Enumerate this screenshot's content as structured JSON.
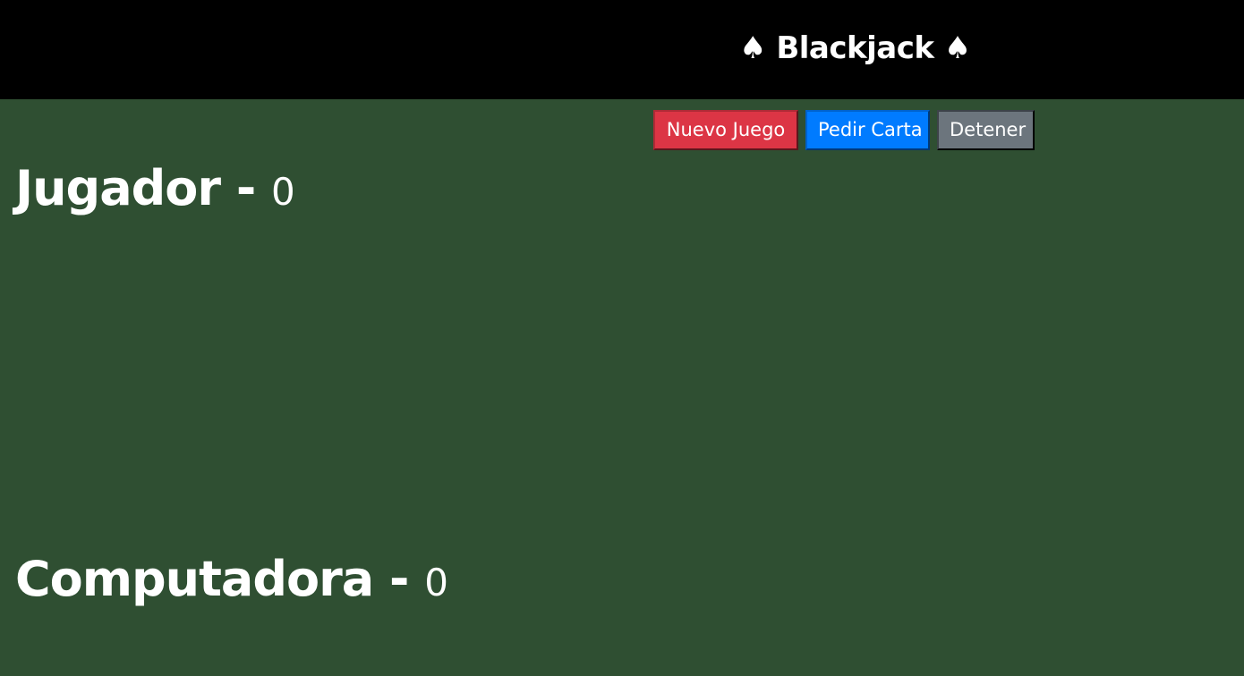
{
  "header": {
    "title": "♠ Blackjack ♠"
  },
  "controls": {
    "new_game_label": "Nuevo Juego",
    "hit_label": "Pedir Carta",
    "stand_label": "Detener"
  },
  "player": {
    "label": "Jugador",
    "separator": " - ",
    "score": "0"
  },
  "computer": {
    "label": "Computadora",
    "separator": " - ",
    "score": "0"
  },
  "colors": {
    "table": "#2f4f32",
    "header": "#000000",
    "danger": "#dc3545",
    "primary": "#007bff",
    "secondary": "#6c757d"
  }
}
